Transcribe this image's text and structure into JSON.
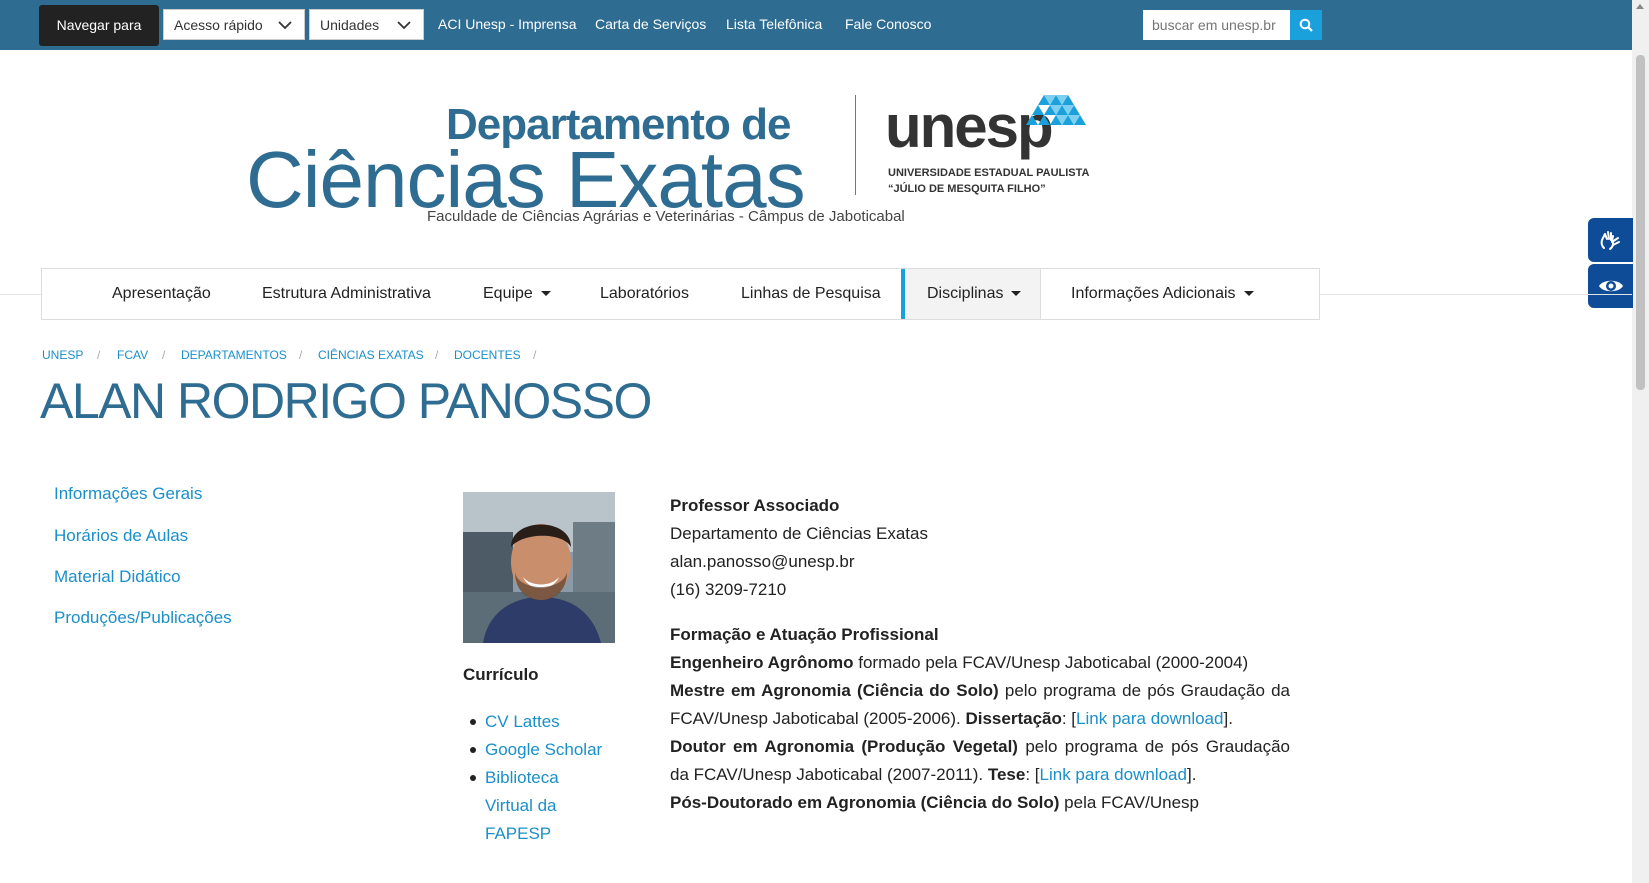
{
  "topbar": {
    "nav_to": "Navegar para",
    "quick_access": "Acesso rápido",
    "units": "Unidades",
    "links": [
      "ACI Unesp - Imprensa",
      "Carta de Serviços",
      "Lista Telefônica",
      "Fale Conosco"
    ],
    "search_placeholder": "buscar em unesp.br"
  },
  "header": {
    "line1": "Departamento de",
    "line2": "Ciências Exatas",
    "subtitle": "Faculdade de Ciências Agrárias e Veterinárias - Câmpus de Jaboticabal",
    "logo_word": "unesp",
    "logo_sub1": "UNIVERSIDADE ESTADUAL PAULISTA",
    "logo_sub2": "“JÚLIO DE MESQUITA FILHO”"
  },
  "nav": {
    "items": [
      "Apresentação",
      "Estrutura Administrativa",
      "Equipe",
      "Laboratórios",
      "Linhas de Pesquisa",
      "Disciplinas",
      "Informações Adicionais"
    ],
    "active": "Disciplinas"
  },
  "breadcrumb": [
    "UNESP",
    "FCAV",
    "DEPARTAMENTOS",
    "CIÊNCIAS EXATAS",
    "DOCENTES"
  ],
  "page_title": "ALAN RODRIGO PANOSSO",
  "side_menu": [
    "Informações Gerais",
    "Horários de Aulas",
    "Material Didático",
    "Produções/Publicações"
  ],
  "curriculum": {
    "title": "Currículo",
    "links": [
      "CV Lattes",
      "Google Scholar",
      "Biblioteca Virtual da FAPESP"
    ]
  },
  "profile": {
    "position": "Professor Associado",
    "department": "Departamento de Ciências Exatas",
    "email": "alan.panosso@unesp.br",
    "phone": "(16) 3209-7210",
    "section_title": "Formação e Atuação Profissional",
    "eng_bold": "Engenheiro Agrônomo",
    "eng_rest": " formado pela FCAV/Unesp Jaboticabal (2000-2004)",
    "ms_bold": "Mestre em Agronomia (Ciência do Solo)",
    "ms_rest": " pelo programa de pós Graudação da FCAV/Unesp Jaboticabal (2005-2006). ",
    "ms_doc_bold": "Dissertação",
    "ms_doc_sep": ": [",
    "ms_link": "Link para download",
    "ms_close": "].",
    "phd_bold": "Doutor em Agronomia (Produção Vegetal)",
    "phd_rest": " pelo programa de pós Graudação da FCAV/Unesp Jaboticabal (2007-2011). ",
    "phd_doc_bold": "Tese",
    "phd_doc_sep": ": [",
    "phd_link": "Link para download",
    "phd_close": "].",
    "postdoc_bold": "Pós-Doutorado em Agronomia (Ciência do Solo)",
    "postdoc_rest": " pela FCAV/Unesp"
  }
}
